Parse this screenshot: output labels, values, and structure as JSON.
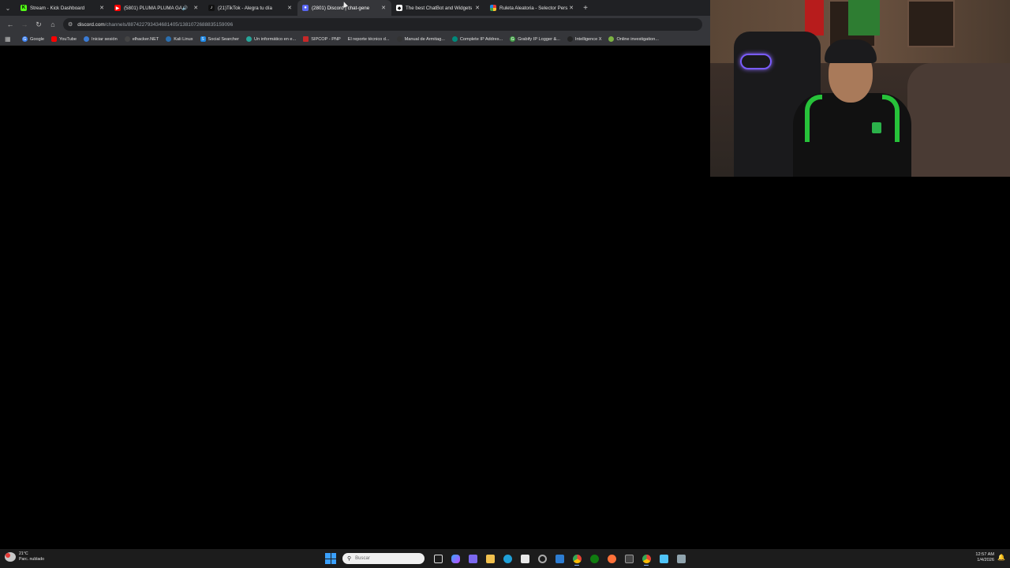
{
  "browser": {
    "tabs": [
      {
        "title": "Stream - Kick Dashboard",
        "favicon": "kick-icon",
        "color": "#53fc18",
        "active": false,
        "audio": false
      },
      {
        "title": "(5801) PLUMA PLUMA GAY",
        "favicon": "youtube-icon",
        "color": "#ff0000",
        "active": false,
        "audio": true
      },
      {
        "title": "(21)TikTok - Alegra tu día",
        "favicon": "tiktok-icon",
        "color": "#111111",
        "active": false,
        "audio": false
      },
      {
        "title": "(2801) Discord | chat-gene",
        "favicon": "discord-icon",
        "color": "#5865f2",
        "active": true,
        "audio": false
      },
      {
        "title": "The best ChatBot and Widgets",
        "favicon": "chatbot-icon",
        "color": "#ffffff",
        "active": false,
        "audio": false
      },
      {
        "title": "Ruleta Aleatoria - Selector Pers",
        "favicon": "wheel-icon",
        "color": "#e53935",
        "active": false,
        "audio": false
      }
    ],
    "address": {
      "host": "discord.com",
      "path": "/channels/887422793434681405/1381072688835159096"
    },
    "bookmarks": [
      {
        "label": "Google",
        "color": "#4285f4"
      },
      {
        "label": "YouTube",
        "color": "#ff0000"
      },
      {
        "label": "Iniciar sesión",
        "color": "#3a7bd5"
      },
      {
        "label": "elhacker.NET",
        "color": "#444444"
      },
      {
        "label": "Kali Linux",
        "color": "#2a6fb0"
      },
      {
        "label": "Social Searcher",
        "color": "#1e88e5"
      },
      {
        "label": "Un informático en e...",
        "color": "#26a69a"
      },
      {
        "label": "SIPCOP - PNP",
        "color": "#c62828"
      },
      {
        "label": "El reporte técnico d...",
        "color": "#555555"
      },
      {
        "label": "Manual de Armitag...",
        "color": "#333333"
      },
      {
        "label": "Complete IP Addres...",
        "color": "#00897b"
      },
      {
        "label": "Grabify IP Logger &...",
        "color": "#43a047"
      },
      {
        "label": "Intelligence X",
        "color": "#222222"
      },
      {
        "label": "Online investigation...",
        "color": "#7cb342"
      }
    ]
  },
  "taskbar": {
    "weather_temp": "21°C",
    "weather_desc": "Parc. nublado",
    "search_placeholder": "Buscar",
    "time": "12:57 AM",
    "date": "1/4/2026"
  }
}
